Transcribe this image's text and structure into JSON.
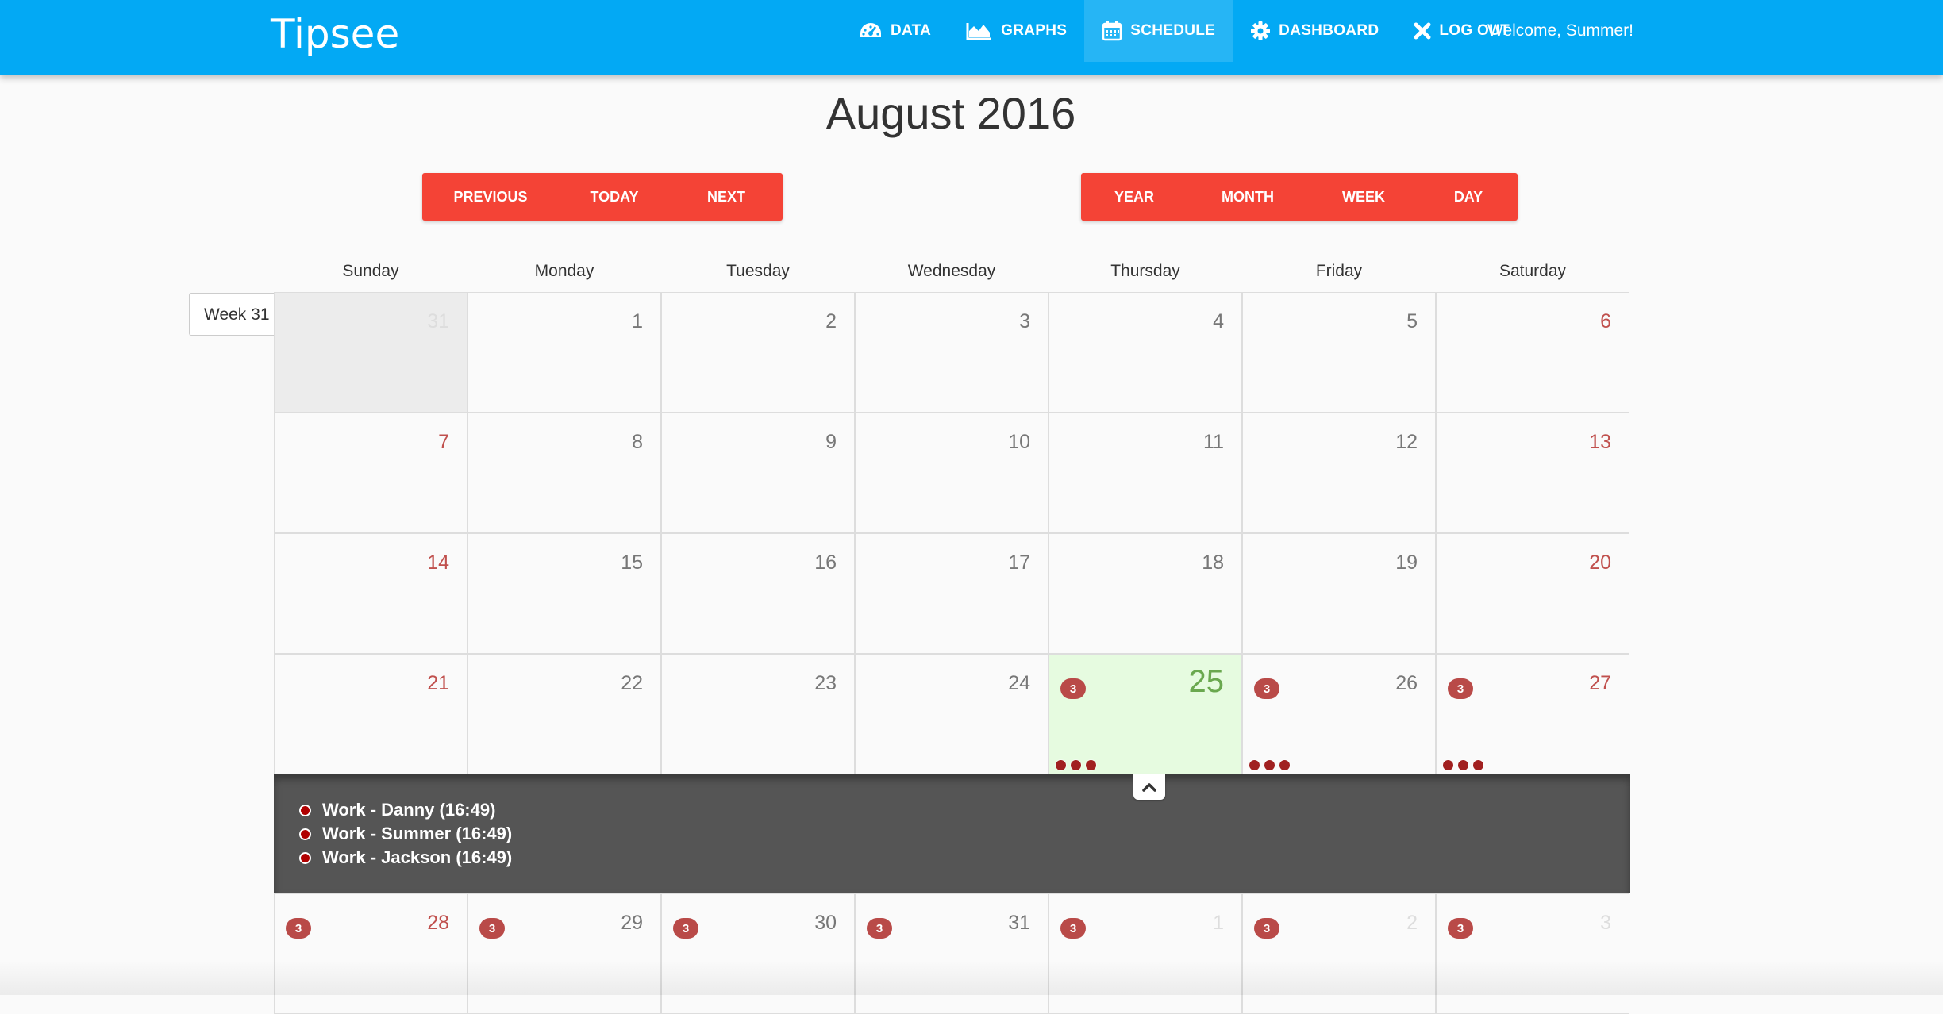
{
  "app": {
    "brand": "Tipsee",
    "welcome": "Welcome, Summer!"
  },
  "nav": [
    {
      "label": "DATA",
      "icon": "dashboard-gauge-icon"
    },
    {
      "label": "GRAPHS",
      "icon": "area-chart-icon"
    },
    {
      "label": "SCHEDULE",
      "icon": "calendar-icon",
      "active": true
    },
    {
      "label": "DASHBOARD",
      "icon": "gear-icon"
    },
    {
      "label": "LOG OUT",
      "icon": "close-icon"
    }
  ],
  "calendar": {
    "title": "August 2016",
    "nav_buttons": {
      "previous": "PREVIOUS",
      "today": "TODAY",
      "next": "NEXT"
    },
    "view_buttons": {
      "year": "YEAR",
      "month": "MONTH",
      "week": "WEEK",
      "day": "DAY"
    },
    "weekdays": [
      "Sunday",
      "Monday",
      "Tuesday",
      "Wednesday",
      "Thursday",
      "Friday",
      "Saturday"
    ],
    "week_label": "Week 31",
    "weeks": [
      [
        "31",
        "1",
        "2",
        "3",
        "4",
        "5",
        "6"
      ],
      [
        "7",
        "8",
        "9",
        "10",
        "11",
        "12",
        "13"
      ],
      [
        "14",
        "15",
        "16",
        "17",
        "18",
        "19",
        "20"
      ],
      [
        "21",
        "22",
        "23",
        "24",
        "25",
        "26",
        "27"
      ],
      [
        "28",
        "29",
        "30",
        "31",
        "1",
        "2",
        "3"
      ]
    ],
    "today": "25",
    "event_badge_count": "3",
    "expanded_events": [
      "Work - Danny (16:49)",
      "Work - Summer (16:49)",
      "Work - Jackson (16:49)"
    ],
    "colors": {
      "navbar": "#03a9f4",
      "buttons": "#f44336",
      "today_bg": "#e6fbe0",
      "today_text": "#6aa84f",
      "weekend_text": "#c0504d",
      "badge": "#b94a48",
      "event_dot": "#a12020",
      "events_panel": "#555555"
    }
  }
}
